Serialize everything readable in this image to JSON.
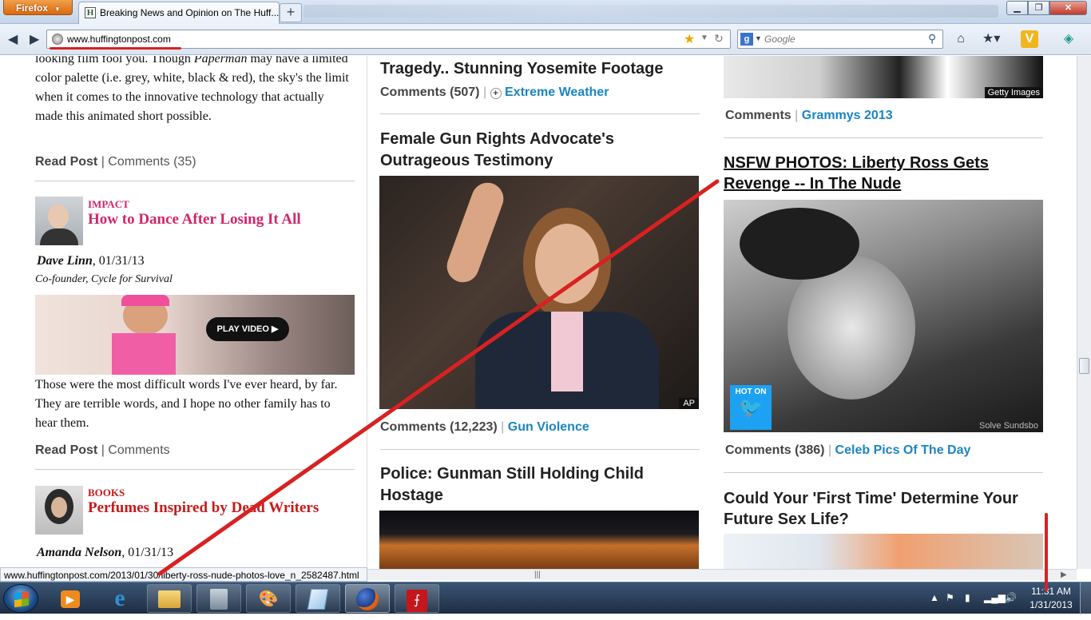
{
  "browser": {
    "app_menu": "Firefox",
    "tab_title": "Breaking News and Opinion on The Huff...",
    "favicon_letter": "H",
    "url": "www.huffingtonpost.com",
    "search_placeholder": "Google",
    "status_url": "www.huffingtonpost.com/2013/01/30/liberty-ross-nude-photos-love_n_2582487.html"
  },
  "left_column": {
    "post1": {
      "body_italic": "Paperman",
      "body_before": "looking film fool you. Though ",
      "body_after": " may have a limited color palette (i.e. grey, white, black & red), the sky's the limit when it comes to the innovative technology that actually made this animated short possible.",
      "read_post": "Read Post",
      "comments": "Comments (35)"
    },
    "post2": {
      "category": "IMPACT",
      "title": "How to Dance After Losing It All",
      "author": "Dave Linn",
      "date": ", 01/31/13",
      "author_desc": "Co-founder, Cycle for Survival",
      "video_label": "PLAY VIDEO",
      "body": "Those were the most difficult words I've ever heard, by far. They are terrible words, and I hope no other family has to hear them.",
      "read_post": "Read Post",
      "comments": "Comments"
    },
    "post3": {
      "category": "BOOKS",
      "title": "Perfumes Inspired by Dead Writers",
      "author": "Amanda Nelson",
      "date": ", 01/31/13"
    }
  },
  "middle_column": {
    "story1": {
      "title_tail": "Tragedy.. Stunning Yosemite Footage",
      "comments": "Comments (507)",
      "tag": "Extreme Weather"
    },
    "story2": {
      "title": "Female Gun Rights Advocate's Outrageous Testimony",
      "photo_credit": "AP",
      "comments": "Comments (12,223)",
      "tag": "Gun Violence"
    },
    "story3": {
      "title": "Police: Gunman Still Holding Child Hostage"
    }
  },
  "right_column": {
    "story1": {
      "photo_credit": "Getty Images",
      "comments": "Comments",
      "tag": "Grammys 2013"
    },
    "story2": {
      "title": "NSFW PHOTOS: Liberty Ross Gets Revenge -- In The Nude",
      "badge_line1": "HOT ON",
      "photo_credit": "Solve Sundsbo",
      "comments": "Comments (386)",
      "tag": "Celeb Pics Of The Day"
    },
    "story3": {
      "title": "Could Your 'First Time' Determine Your Future Sex Life?"
    }
  },
  "taskbar": {
    "clock_time": "11:31 AM",
    "clock_date": "1/31/2013"
  },
  "colors": {
    "huffpost_pink": "#d0266b",
    "books_red": "#c71b1b",
    "tag_blue": "#1b84c2",
    "annotation_red": "#d82121"
  }
}
